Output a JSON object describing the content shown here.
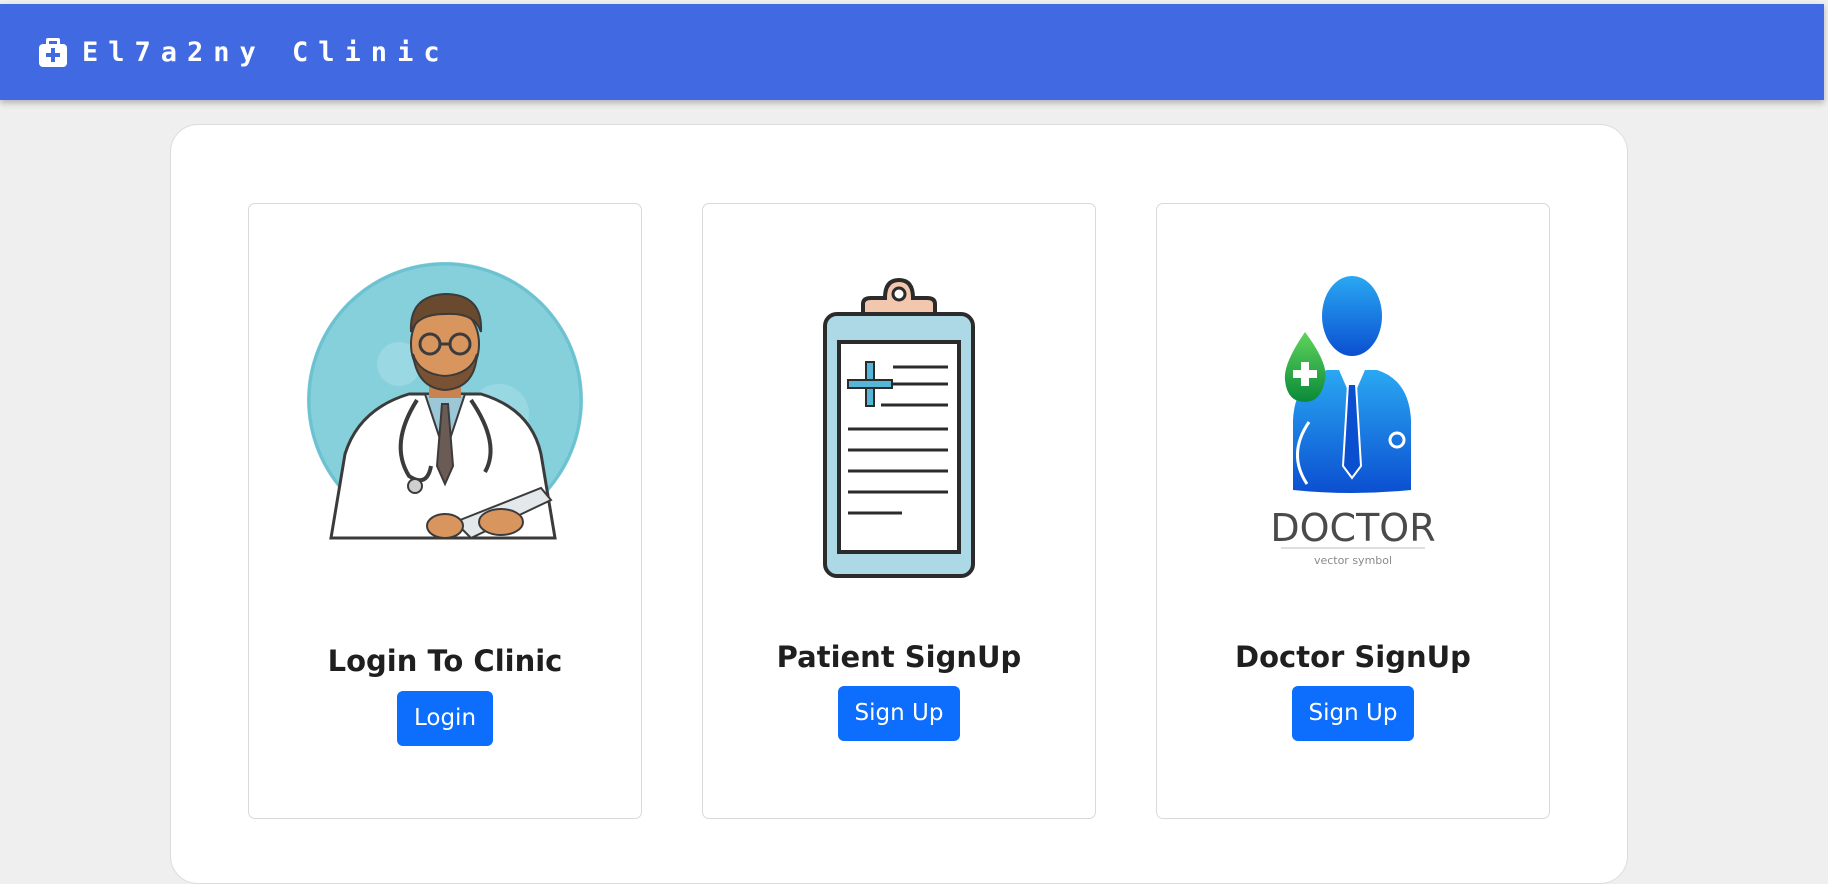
{
  "navbar": {
    "brand_icon": "medkit-icon",
    "brand_name": "El7a2ny Clinic",
    "background_color": "#4169e1"
  },
  "cards": [
    {
      "illustration": "doctor-illustration",
      "title": "Login To Clinic",
      "button_label": "Login"
    },
    {
      "illustration": "clipboard-icon",
      "title": "Patient SignUp",
      "button_label": "Sign Up"
    },
    {
      "illustration": "doctor-silhouette-icon",
      "logo_word": "DOCTOR",
      "logo_caption": "vector symbol",
      "title": "Doctor SignUp",
      "button_label": "Sign Up"
    }
  ],
  "colors": {
    "button": "#0d6efd",
    "page_background": "#efefef",
    "panel_background": "#ffffff"
  }
}
